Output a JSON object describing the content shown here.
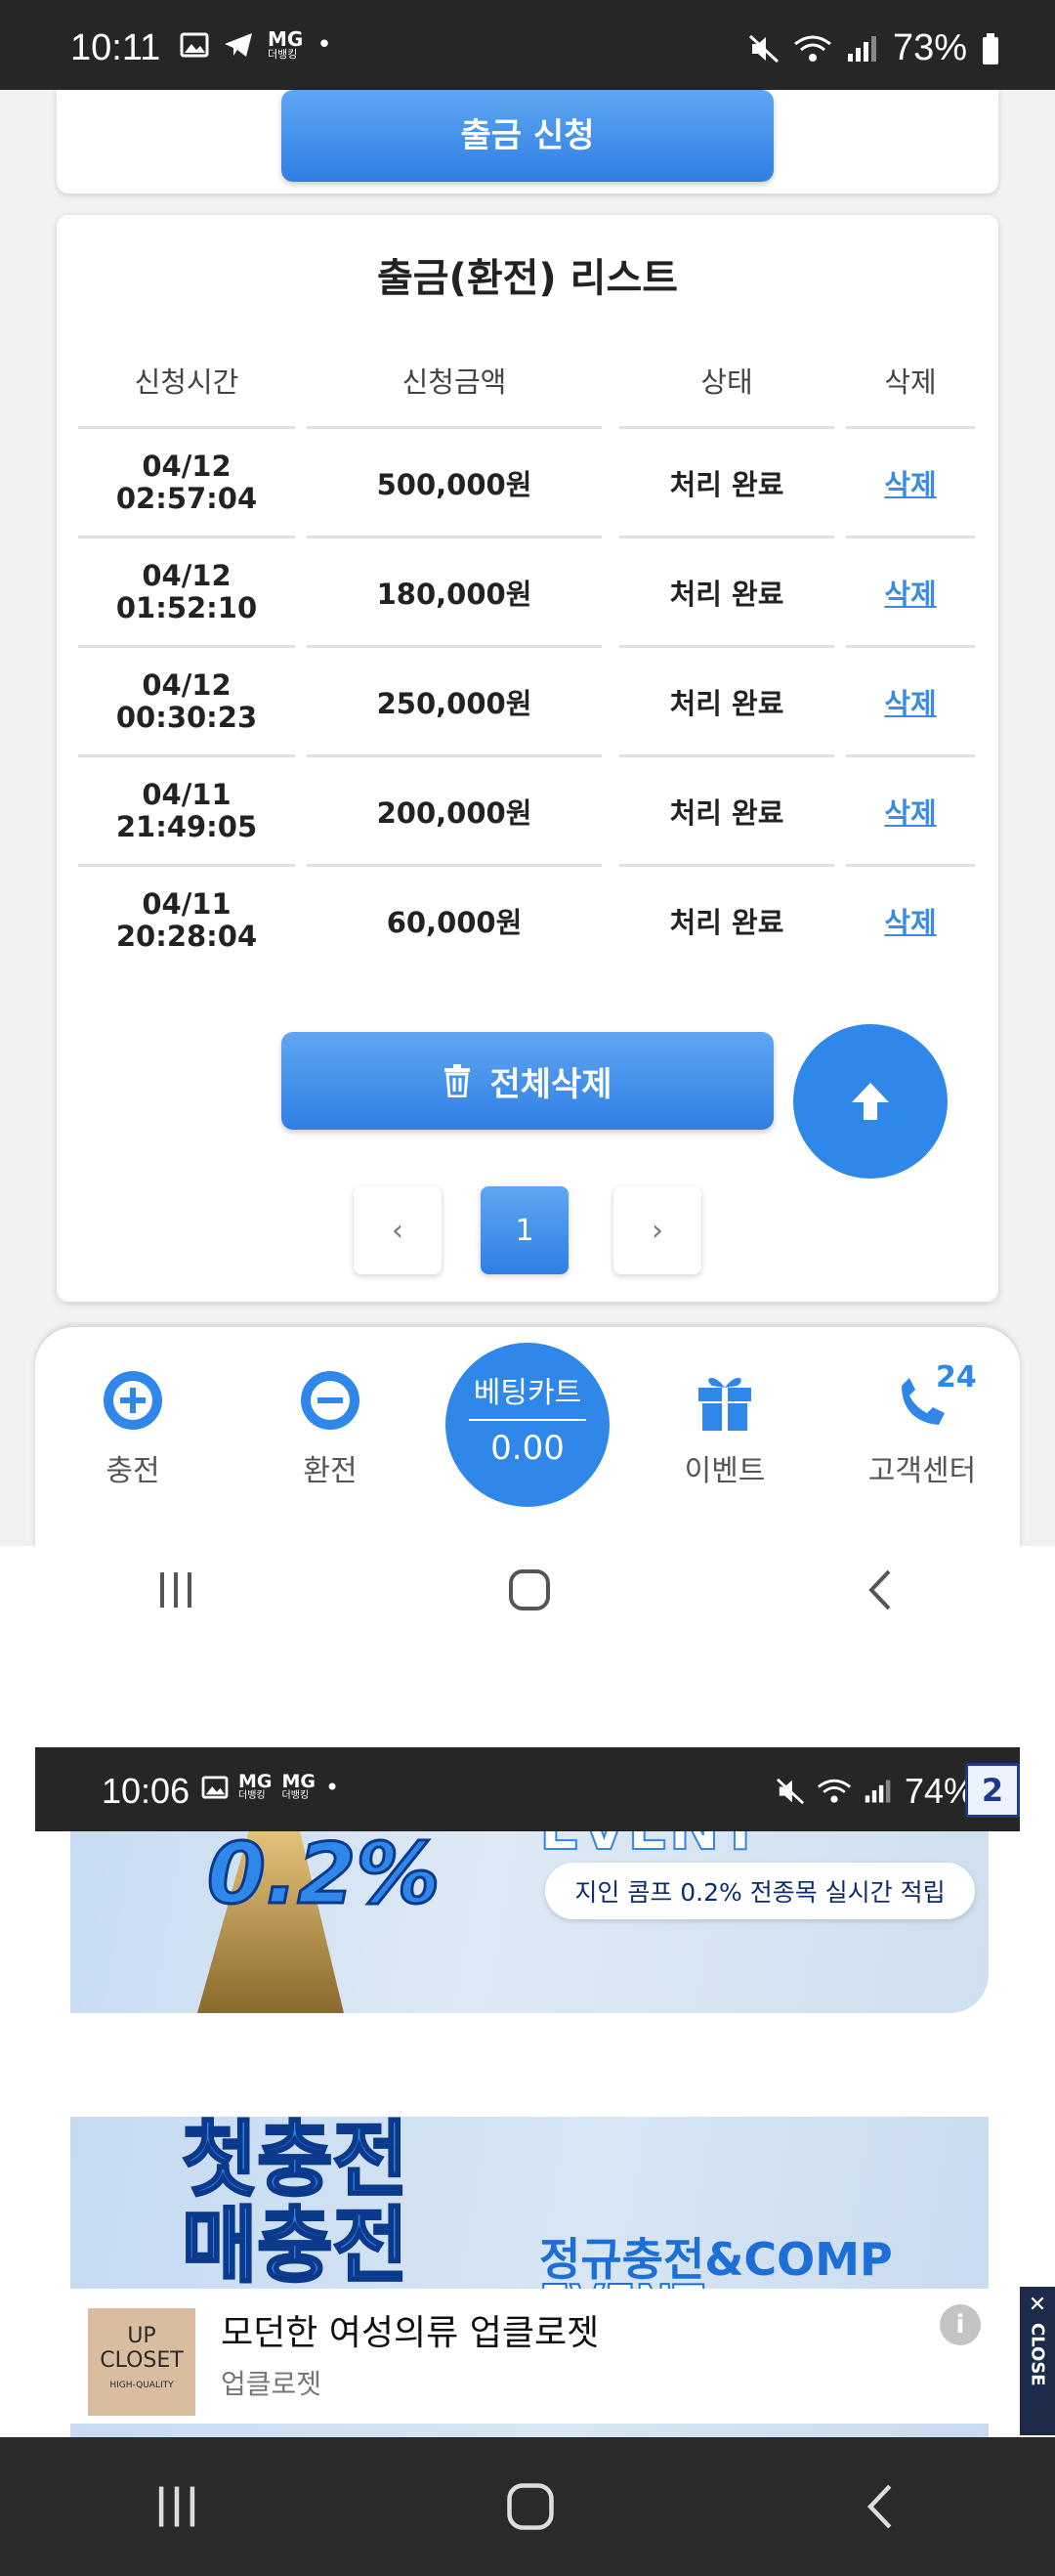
{
  "status_bar": {
    "time": "10:11",
    "mg_label": "MG",
    "mg_sub": "더뱅킹",
    "battery": "73%"
  },
  "apply_button": "출금 신청",
  "list": {
    "title": "출금(환전) 리스트",
    "headers": [
      "신청시간",
      "신청금액",
      "상태",
      "삭제"
    ],
    "rows": [
      {
        "date": "04/12",
        "time": "02:57:04",
        "amount": "500,000원",
        "status": "처리 완료",
        "delete": "삭제"
      },
      {
        "date": "04/12",
        "time": "01:52:10",
        "amount": "180,000원",
        "status": "처리 완료",
        "delete": "삭제"
      },
      {
        "date": "04/12",
        "time": "00:30:23",
        "amount": "250,000원",
        "status": "처리 완료",
        "delete": "삭제"
      },
      {
        "date": "04/11",
        "time": "21:49:05",
        "amount": "200,000원",
        "status": "처리 완료",
        "delete": "삭제"
      },
      {
        "date": "04/11",
        "time": "20:28:04",
        "amount": "60,000원",
        "status": "처리 완료",
        "delete": "삭제"
      }
    ],
    "delete_all": "전체삭제"
  },
  "pagination": {
    "prev": "‹",
    "current": "1",
    "next": "›"
  },
  "bottom_nav": {
    "charge": "충전",
    "exchange": "환전",
    "bet_cart_label": "베팅카트",
    "bet_cart_value": "0.00",
    "event": "이벤트",
    "support": "고객센터",
    "support_badge": "24"
  },
  "second_screenshot": {
    "time": "10:06",
    "mg1": "MG",
    "mg1_sub": "더뱅킹",
    "mg2": "MG",
    "mg2_sub": "더뱅킹",
    "battery": "74%",
    "badge": "2",
    "banner1_percent": "0.2%",
    "banner1_event": "EVENT",
    "banner1_caption": "지인 콤프 0.2% 전종목 실시간 적립",
    "banner2_left_line1": "첫충전",
    "banner2_left_line2": "매충전",
    "banner2_right": "정규충전&COMP",
    "banner2_event": "EVENT"
  },
  "ad": {
    "logo_line1": "UP",
    "logo_line2": "CLOSET",
    "logo_line3": "HIGH-QUALITY",
    "title": "모던한 여성의류 업클로젯",
    "subtitle": "업클로젯",
    "close_label": "CLOSE",
    "close_x": "✕"
  },
  "colors": {
    "accent": "#2f87ea",
    "link": "#3b8be0",
    "statusbar": "#262626"
  }
}
